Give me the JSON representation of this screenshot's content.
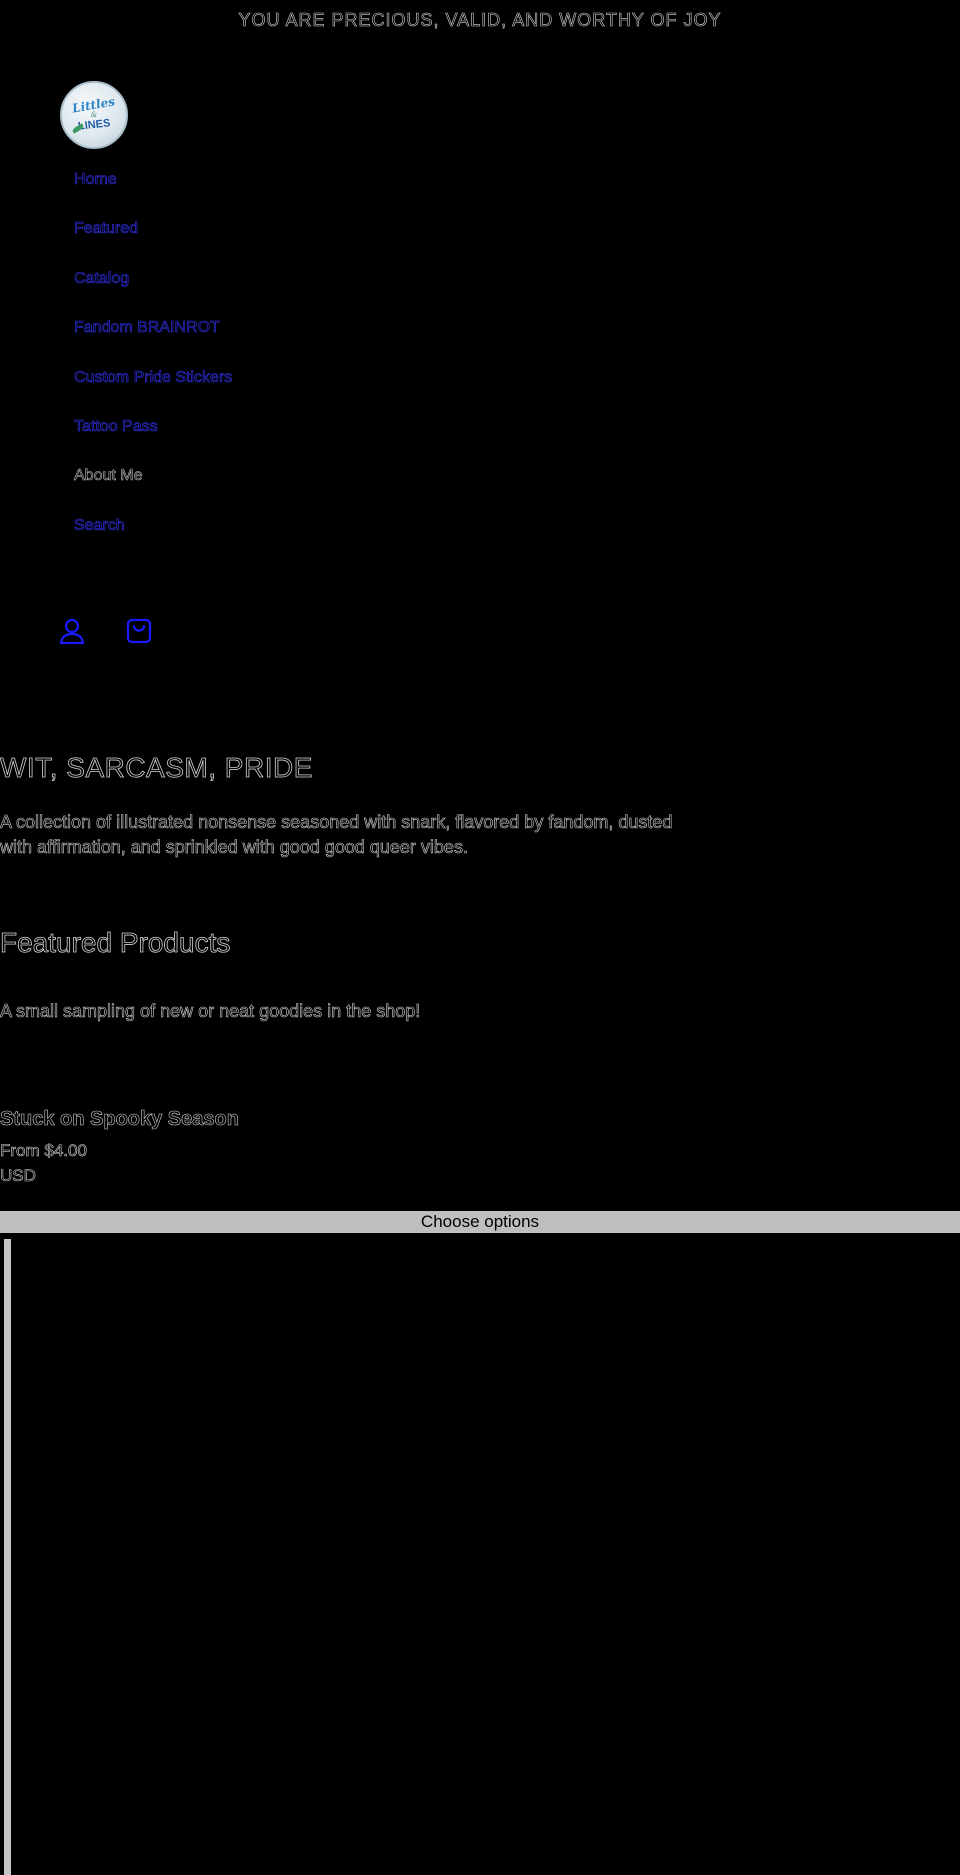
{
  "announcement": {
    "text": "YOU ARE PRECIOUS, VALID, AND WORTHY OF JOY"
  },
  "header": {
    "logo": {
      "line1": "Littles",
      "line2": "&",
      "line3": "LINES"
    },
    "nav": [
      {
        "label": "Home"
      },
      {
        "label": "Featured"
      },
      {
        "label": "Catalog"
      },
      {
        "label": "Fandom BRAINROT"
      },
      {
        "label": "Custom Pride Stickers"
      },
      {
        "label": "Tattoo Pass"
      },
      {
        "label": "About Me"
      },
      {
        "label": "Search"
      }
    ],
    "icons": {
      "account": "user-icon",
      "cart": "shopping-bag-icon"
    }
  },
  "hero": {
    "title": "WIT, SARCASM, PRIDE",
    "text": "A collection of illustrated nonsense seasoned with snark, flavored by fandom, dusted with affirmation, and sprinkled with good good queer vibes."
  },
  "featured": {
    "title": "Featured Products",
    "subtitle": "A small sampling of new or neat goodies in the shop!"
  },
  "product": {
    "name": "Stuck on Spooky Season",
    "price_from": "From $4.00",
    "currency": "USD",
    "button_label": "Choose options"
  },
  "colors": {
    "background": "#000000",
    "link": "#3535ff",
    "button_bg": "#bebebe",
    "media_border": "#c4c4c4"
  }
}
